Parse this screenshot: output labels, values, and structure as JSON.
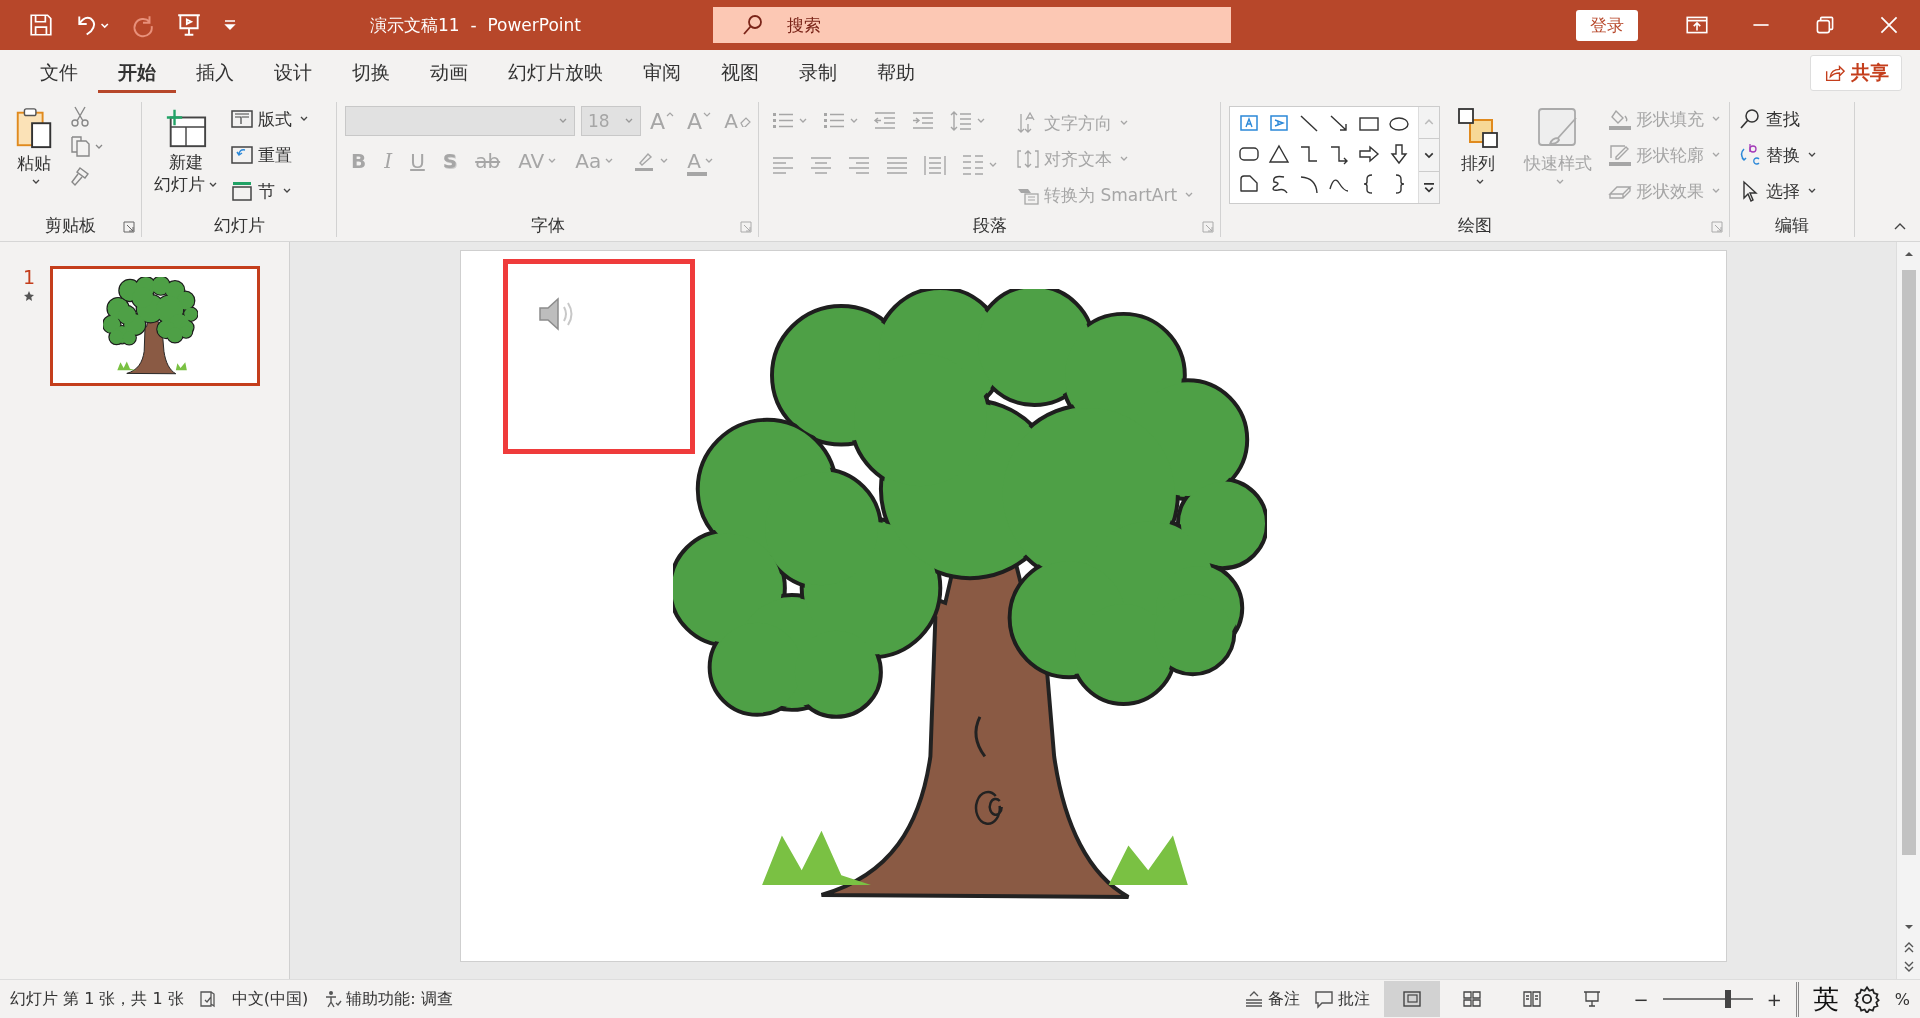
{
  "title_bar": {
    "title": "演示文稿11  -  PowerPoint",
    "search": {
      "placeholder": "搜索"
    },
    "sign_in": "登录"
  },
  "quick_access": [
    {
      "kind": "save",
      "disabled": false
    },
    {
      "kind": "undo",
      "disabled": false
    },
    {
      "kind": "redo",
      "disabled": true
    },
    {
      "kind": "present",
      "disabled": false
    },
    {
      "kind": "customize",
      "disabled": false
    }
  ],
  "tabs": [
    {
      "label": "文件",
      "selected": false
    },
    {
      "label": "开始",
      "selected": true
    },
    {
      "label": "插入",
      "selected": false
    },
    {
      "label": "设计",
      "selected": false
    },
    {
      "label": "切换",
      "selected": false
    },
    {
      "label": "动画",
      "selected": false
    },
    {
      "label": "幻灯片放映",
      "selected": false
    },
    {
      "label": "审阅",
      "selected": false
    },
    {
      "label": "视图",
      "selected": false
    },
    {
      "label": "录制",
      "selected": false
    },
    {
      "label": "帮助",
      "selected": false
    }
  ],
  "share": "共享",
  "ribbon": {
    "clipboard": {
      "label": "剪贴板",
      "paste": "粘贴"
    },
    "slides": {
      "label": "幻灯片",
      "new_slide": [
        "新建",
        "幻灯片"
      ],
      "items": [
        {
          "kind": "layout",
          "label": "版式",
          "dropdown": true
        },
        {
          "kind": "reset",
          "label": "重置",
          "dropdown": false
        },
        {
          "kind": "section",
          "label": "节",
          "dropdown": true
        }
      ]
    },
    "font": {
      "label": "字体",
      "font_name": {
        "disabled": true
      },
      "font_size": {
        "value": "18",
        "disabled": true
      },
      "size_buttons": [
        {
          "kind": "grow",
          "glyph": "A",
          "disabled": true
        },
        {
          "kind": "shrink",
          "glyph": "A",
          "disabled": true
        },
        {
          "kind": "clear",
          "glyph": "A",
          "disabled": true
        }
      ],
      "format_buttons": [
        {
          "kind": "bold",
          "glyph": "B",
          "dropdown": false,
          "disabled": true
        },
        {
          "kind": "italic",
          "glyph": "I",
          "dropdown": false,
          "disabled": true
        },
        {
          "kind": "underline",
          "glyph": "U",
          "dropdown": false,
          "disabled": true
        },
        {
          "kind": "shadow",
          "glyph": "S",
          "dropdown": false,
          "disabled": true
        },
        {
          "kind": "strike",
          "glyph": "ab",
          "dropdown": false,
          "disabled": true
        },
        {
          "kind": "spacing",
          "glyph": "AV",
          "dropdown": true,
          "disabled": true
        },
        {
          "kind": "case",
          "glyph": "Aa",
          "dropdown": true,
          "disabled": true
        },
        {
          "kind": "highlight",
          "dropdown": true,
          "disabled": true
        },
        {
          "kind": "color",
          "glyph": "A",
          "dropdown": true,
          "disabled": true
        }
      ]
    },
    "paragraph": {
      "label": "段落",
      "list_buttons": [
        {
          "kind": "bullets",
          "dropdown": true,
          "disabled": true
        },
        {
          "kind": "numbering",
          "dropdown": true,
          "disabled": true
        },
        {
          "kind": "outdent",
          "dropdown": false,
          "disabled": true
        },
        {
          "kind": "indent",
          "dropdown": false,
          "disabled": true
        },
        {
          "kind": "line_spacing",
          "dropdown": true,
          "disabled": true
        }
      ],
      "align_buttons": [
        {
          "kind": "align_left",
          "dropdown": false,
          "disabled": true
        },
        {
          "kind": "align_center",
          "dropdown": false,
          "disabled": true
        },
        {
          "kind": "align_right",
          "dropdown": false,
          "disabled": true
        },
        {
          "kind": "justify",
          "dropdown": false,
          "disabled": true
        },
        {
          "kind": "distribute",
          "dropdown": false,
          "disabled": true
        },
        {
          "kind": "columns",
          "dropdown": true,
          "disabled": true
        }
      ],
      "text_buttons": [
        {
          "kind": "direction",
          "label": "文字方向",
          "disabled": true
        },
        {
          "kind": "align",
          "label": "对齐文本",
          "disabled": true
        },
        {
          "kind": "smartart",
          "label": "转换为 SmartArt",
          "disabled": true
        }
      ]
    },
    "drawing": {
      "label": "绘图",
      "arrange": "排列",
      "quick_styles": {
        "label": "快速样式",
        "disabled": true
      },
      "shape_buttons": [
        {
          "kind": "fill",
          "label": "形状填充",
          "disabled": true
        },
        {
          "kind": "outline",
          "label": "形状轮廓",
          "disabled": true
        },
        {
          "kind": "effects",
          "label": "形状效果",
          "disabled": true
        }
      ]
    },
    "editing": {
      "label": "编辑",
      "items": [
        {
          "kind": "find",
          "label": "查找",
          "dropdown": false
        },
        {
          "kind": "replace",
          "label": "替换",
          "dropdown": true
        },
        {
          "kind": "select",
          "label": "选择",
          "dropdown": true
        }
      ]
    }
  },
  "thumbnails": [
    {
      "number": "1",
      "selected": true
    }
  ],
  "status_bar": {
    "slide_info": "幻灯片 第 1 张，共 1 张",
    "language": "中文(中国)",
    "accessibility": "辅助功能: 调查",
    "notes": "备注",
    "comments": "批注",
    "views": [
      {
        "kind": "normal",
        "selected": true
      },
      {
        "kind": "sorter",
        "selected": false
      },
      {
        "kind": "reading",
        "selected": false
      },
      {
        "kind": "slideshow",
        "selected": false
      }
    ],
    "zoom_out": "−",
    "zoom": {
      "level": 0.72
    },
    "zoom_in": "+",
    "ime": "英",
    "zoom_percent": "%"
  }
}
